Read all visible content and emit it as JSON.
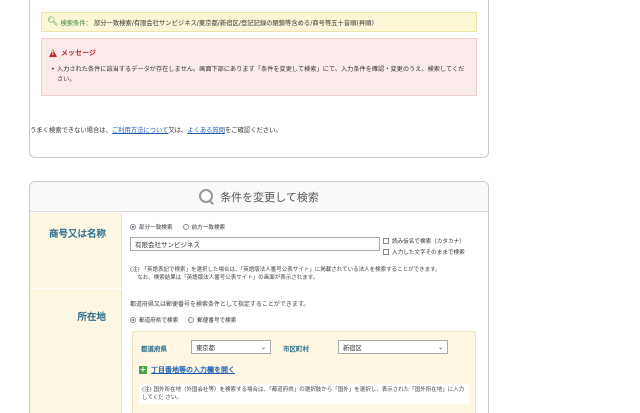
{
  "conditions": {
    "label": "検索条件：",
    "value": "部分一致検索/有限会社サンビジネス/東京都/新宿区/登記記録の閉鎖等含める/商号等五十音順(昇順)"
  },
  "message": {
    "title": "メッセージ",
    "body": "入力された条件に該当するデータが存在しません。画面下部にあります「条件を変更して検索」にて、入力条件を確認・変更のうえ、検索してください。"
  },
  "help": {
    "prefix": "うまく検索できない場合は、",
    "link1": "ご利用方法について",
    "middle": "又は、",
    "link2": "よくある質問",
    "suffix": "をご確認ください。"
  },
  "search": {
    "header": "条件を変更して検索",
    "name_section": {
      "label": "商号又は名称",
      "radio_partial": "部分一致検索",
      "radio_prefix": "前方一致検索",
      "value": "有限会社サンビジネス",
      "check_kana": "読み仮名で検索（カタカナ）",
      "check_exact": "入力した文字そのままで検索",
      "note": "(注) 「英語表記で検索」を選択した場合は、「英語版法人番号公表サイト」に掲載されている法人を検索することができます。\n　 なお、検索結果は「英語版法人番号公表サイト」の画面が表示されます。"
    },
    "location_section": {
      "label": "所在地",
      "desc": "都道府県又は郵便番号を検索条件として指定することができます。",
      "radio_pref": "都道府県で検索",
      "radio_zip": "郵便番号で検索",
      "pref_label": "都道府県",
      "pref_value": "東京都",
      "city_label": "市区町村",
      "city_value": "新宿区",
      "expand_link": "丁目番地等の入力欄を開く",
      "note": "(注) 国外所在地（外国会社等）を検索する場合は、「都道府県」の選択肢から「国外」を選択し、表示された「国外所在地」に入力してくだ さい。"
    }
  }
}
